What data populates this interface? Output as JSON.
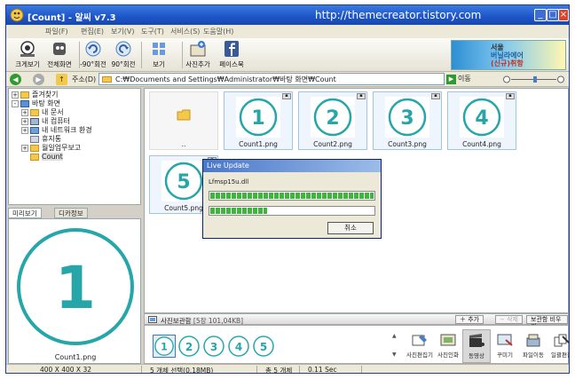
{
  "window": {
    "title": "[Count] - 알씨 v7.3",
    "watermark": "http://themecreator.tistory.com"
  },
  "menu": [
    "파일(F)",
    "편집(E)",
    "보기(V)",
    "도구(T)",
    "서비스(S)",
    "도움말(H)"
  ],
  "toolbar": {
    "buttons": [
      {
        "label": "크게보기",
        "icon": "magnifier-icon"
      },
      {
        "label": "전체화면",
        "icon": "fullscreen-icon"
      },
      {
        "label": "-90°회전",
        "icon": "rotate-left-icon"
      },
      {
        "label": "90°회전",
        "icon": "rotate-right-icon"
      },
      {
        "label": "보기",
        "icon": "view-grid-icon"
      },
      {
        "label": "사진추가",
        "icon": "add-photo-icon"
      },
      {
        "label": "페이스북",
        "icon": "facebook-icon"
      }
    ]
  },
  "ad": {
    "line1": "서울",
    "line2": "버닐라에어",
    "line3": "(신규)취항"
  },
  "address": {
    "label": "주소(D)",
    "value": "C:₩Documents and Settings₩Administrator₩바탕 화면₩Count",
    "go_label": "이동"
  },
  "tree": [
    {
      "label": "즐겨찾기",
      "level": 0,
      "toggle": "+"
    },
    {
      "label": "바탕 화면",
      "level": 0,
      "toggle": "-"
    },
    {
      "label": "내 문서",
      "level": 1,
      "toggle": "+"
    },
    {
      "label": "내 컴퓨터",
      "level": 1,
      "toggle": "+"
    },
    {
      "label": "내 네트워크 환경",
      "level": 1,
      "toggle": "+"
    },
    {
      "label": "휴지통",
      "level": 1,
      "toggle": ""
    },
    {
      "label": "월일업무보고",
      "level": 1,
      "toggle": "+"
    },
    {
      "label": "Count",
      "level": 1,
      "toggle": "",
      "selected": true
    }
  ],
  "panel_tabs": [
    "미리보기",
    "디카정보"
  ],
  "preview": {
    "digit": "1",
    "filename": "Count1.png"
  },
  "thumbnails": [
    {
      "name": "..",
      "type": "folder"
    },
    {
      "name": "Count1.png",
      "digit": "1"
    },
    {
      "name": "Count2.png",
      "digit": "2"
    },
    {
      "name": "Count3.png",
      "digit": "3"
    },
    {
      "name": "Count4.png",
      "digit": "4"
    },
    {
      "name": "Count5.png",
      "digit": "5"
    }
  ],
  "dialog": {
    "title": "Live Update",
    "file": "Lfmsp15u.dll",
    "progress1": 1.0,
    "progress2": 0.35,
    "cancel": "취소"
  },
  "strip": {
    "title": "사진보관함",
    "count": "[5장 101,04KB]",
    "add": "추가",
    "remove": "삭제",
    "empty": "보관함 비우기",
    "digits": [
      "1",
      "2",
      "3",
      "4",
      "5"
    ],
    "actions": [
      "사진편집기",
      "사진인화",
      "동영상",
      "꾸미기",
      "파일이동",
      "일괄편집"
    ]
  },
  "status": {
    "dims": "400 X 400 X 32",
    "selection": "5 개체 선택(0.18MB)",
    "total": "총 5 개체",
    "time": "0.11 Sec"
  },
  "colors": {
    "accent": "#27a6aa",
    "title_bar": "#1d54c8",
    "progress": "#3fb53f"
  }
}
